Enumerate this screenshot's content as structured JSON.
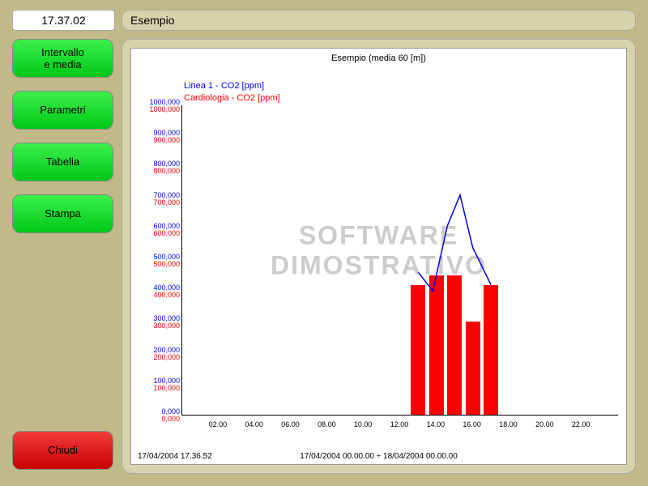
{
  "clock": "17.37.02",
  "title": "Esempio",
  "sidebar": {
    "intervallo": "Intervallo\ne media",
    "parametri": "Parametri",
    "tabella": "Tabella",
    "stampa": "Stampa",
    "chiudi": "Chiudi"
  },
  "watermark": {
    "line1": "SOFTWARE",
    "line2": "DIMOSTRATIVO"
  },
  "footer": {
    "left": "17/04/2004 17.36.52",
    "center": "17/04/2004 00.00.00 ÷ 18/04/2004 00.00.00"
  },
  "chart_data": {
    "type": "bar+line",
    "title": "Esempio (media 60 [m])",
    "xlabel": "",
    "ylabel": "",
    "ylim": [
      0,
      1000000
    ],
    "x_range_hours": [
      0,
      24
    ],
    "x_ticks": [
      "02.00",
      "04.00",
      "06.00",
      "08.00",
      "10.00",
      "12.00",
      "14.00",
      "16.00",
      "18.00",
      "20.00",
      "22.00"
    ],
    "y_ticks": [
      0,
      100000,
      200000,
      300000,
      400000,
      500000,
      600000,
      700000,
      800000,
      900000,
      1000000
    ],
    "y_tick_labels": [
      "0,000",
      "100,000",
      "200,000",
      "300,000",
      "400,000",
      "500,000",
      "600,000",
      "700,000",
      "800,000",
      "900,000",
      "1000,000"
    ],
    "series": [
      {
        "name": "Linea 1 - CO2 [ppm]",
        "style": "line",
        "color": "#0000ff",
        "points": [
          {
            "x": 13.0,
            "y": 460000
          },
          {
            "x": 13.8,
            "y": 400000
          },
          {
            "x": 14.6,
            "y": 610000
          },
          {
            "x": 15.3,
            "y": 710000
          },
          {
            "x": 16.0,
            "y": 540000
          },
          {
            "x": 17.0,
            "y": 420000
          }
        ]
      },
      {
        "name": "Cardiologia - CO2 [ppm]",
        "style": "bar",
        "color": "#ff0000",
        "bars": [
          {
            "x": 13.0,
            "y": 420000
          },
          {
            "x": 14.0,
            "y": 450000
          },
          {
            "x": 15.0,
            "y": 450000
          },
          {
            "x": 16.0,
            "y": 300000
          },
          {
            "x": 17.0,
            "y": 420000
          }
        ],
        "bar_width_hours": 0.8
      }
    ]
  }
}
